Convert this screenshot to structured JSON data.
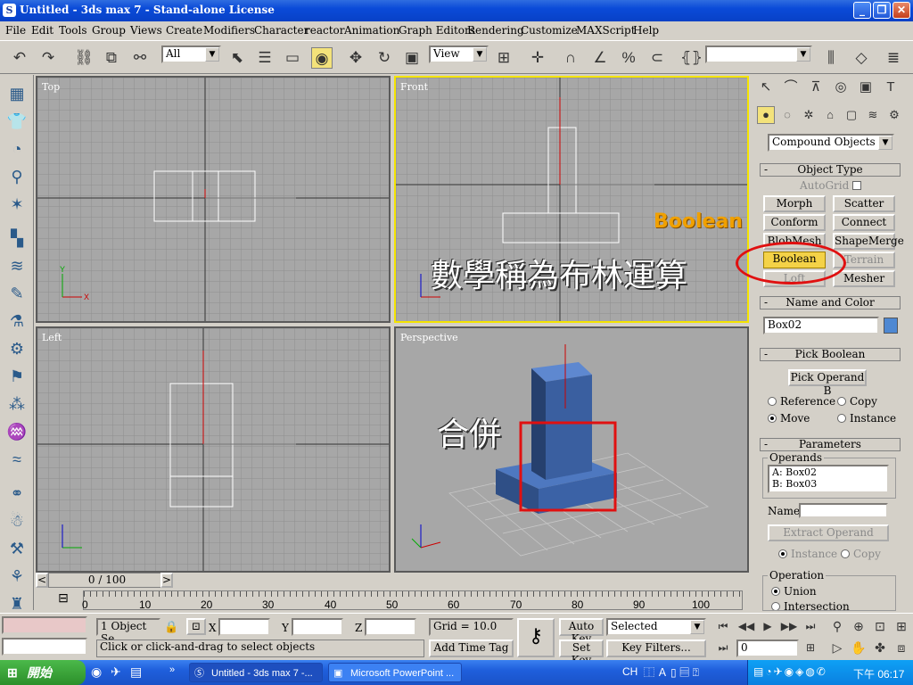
{
  "window": {
    "title": "Untitled - 3ds max 7  - Stand-alone License",
    "min": "_",
    "max": "❐",
    "close": "✕"
  },
  "menu": [
    "File",
    "Edit",
    "Tools",
    "Group",
    "Views",
    "Create",
    "Modifiers",
    "Character",
    "reactor",
    "Animation",
    "Graph Editors",
    "Rendering",
    "Customize",
    "MAXScript",
    "Help"
  ],
  "toolbar": {
    "selection_filter": "All",
    "ref_coord": "View"
  },
  "viewports": {
    "top": "Top",
    "front": "Front",
    "left": "Left",
    "perspective": "Perspective"
  },
  "overlays": {
    "boolean_label": "Boolean",
    "chinese_caption": "數學稱為布林運算",
    "merge_label": "合併"
  },
  "command_panel": {
    "category": "Compound Objects",
    "object_type": {
      "header": "Object Type",
      "autogrid": "AutoGrid",
      "buttons": [
        "Morph",
        "Scatter",
        "Conform",
        "Connect",
        "BlobMesh",
        "ShapeMerge",
        "Boolean",
        "Terrain",
        "Loft",
        "Mesher"
      ]
    },
    "name_color": {
      "header": "Name and Color",
      "name": "Box02",
      "color": "#4e88d2"
    },
    "pick_boolean": {
      "header": "Pick Boolean",
      "pick_button": "Pick Operand B",
      "options": [
        "Reference",
        "Copy",
        "Move",
        "Instance"
      ]
    },
    "parameters": {
      "header": "Parameters",
      "operands_label": "Operands",
      "operands": [
        "A: Box02",
        "B: Box03"
      ],
      "name_label": "Name:",
      "extract_button": "Extract Operand",
      "instance": "Instance",
      "copy": "Copy",
      "operation_label": "Operation",
      "union": "Union",
      "intersection": "Intersection"
    }
  },
  "timeline": {
    "slider": "0 / 100",
    "ticks": [
      "0",
      "10",
      "20",
      "30",
      "40",
      "50",
      "60",
      "70",
      "80",
      "90",
      "100"
    ]
  },
  "status": {
    "selection": "1 Object Se",
    "x_label": "X",
    "y_label": "Y",
    "z_label": "Z",
    "grid": "Grid = 10.0",
    "prompt": "Click or click-and-drag to select objects",
    "add_time_tag": "Add Time Tag",
    "auto_key": "Auto Key",
    "set_key": "Set Key",
    "key_mode": "Selected",
    "key_filters": "Key Filters...",
    "frame": "0"
  },
  "taskbar": {
    "start": "開始",
    "tasks": [
      "Untitled - 3ds max 7 -...",
      "Microsoft PowerPoint ..."
    ],
    "lang": "CH",
    "clock": "下午 06:17"
  }
}
